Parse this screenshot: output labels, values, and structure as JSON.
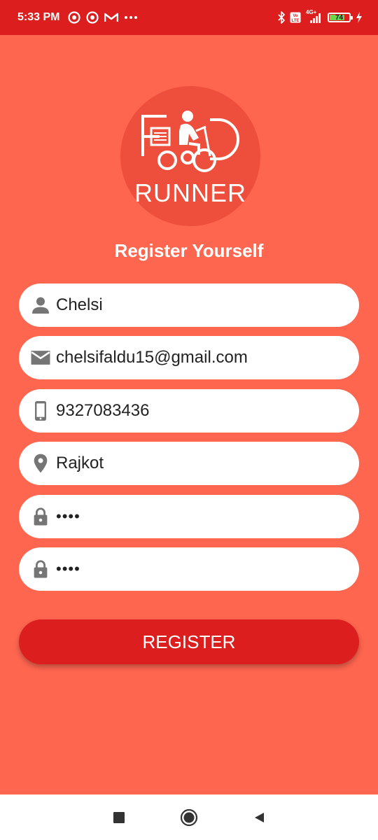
{
  "status_bar": {
    "time": "5:33 PM",
    "network": "4G+",
    "volte": "Vo LTE",
    "battery_level": "74"
  },
  "logo": {
    "brand_word": "RUNNER"
  },
  "form": {
    "title": "Register Yourself",
    "fields": [
      {
        "icon": "person-icon",
        "value": "Chelsi"
      },
      {
        "icon": "email-icon",
        "value": "chelsifaldu15@gmail.com"
      },
      {
        "icon": "phone-icon",
        "value": "9327083436"
      },
      {
        "icon": "location-icon",
        "value": "Rajkot"
      },
      {
        "icon": "lock-icon",
        "value": "••••"
      },
      {
        "icon": "lock-icon",
        "value": "••••"
      }
    ],
    "submit_label": "REGISTER"
  },
  "colors": {
    "background": "#FF6650",
    "primary": "#DC1E1E",
    "logo_circle": "#EE4F3C",
    "field_background": "#FFFFFF",
    "icon_gray": "#757575"
  },
  "nav_bar": {
    "buttons": [
      "recents-icon",
      "home-icon",
      "back-icon"
    ]
  }
}
